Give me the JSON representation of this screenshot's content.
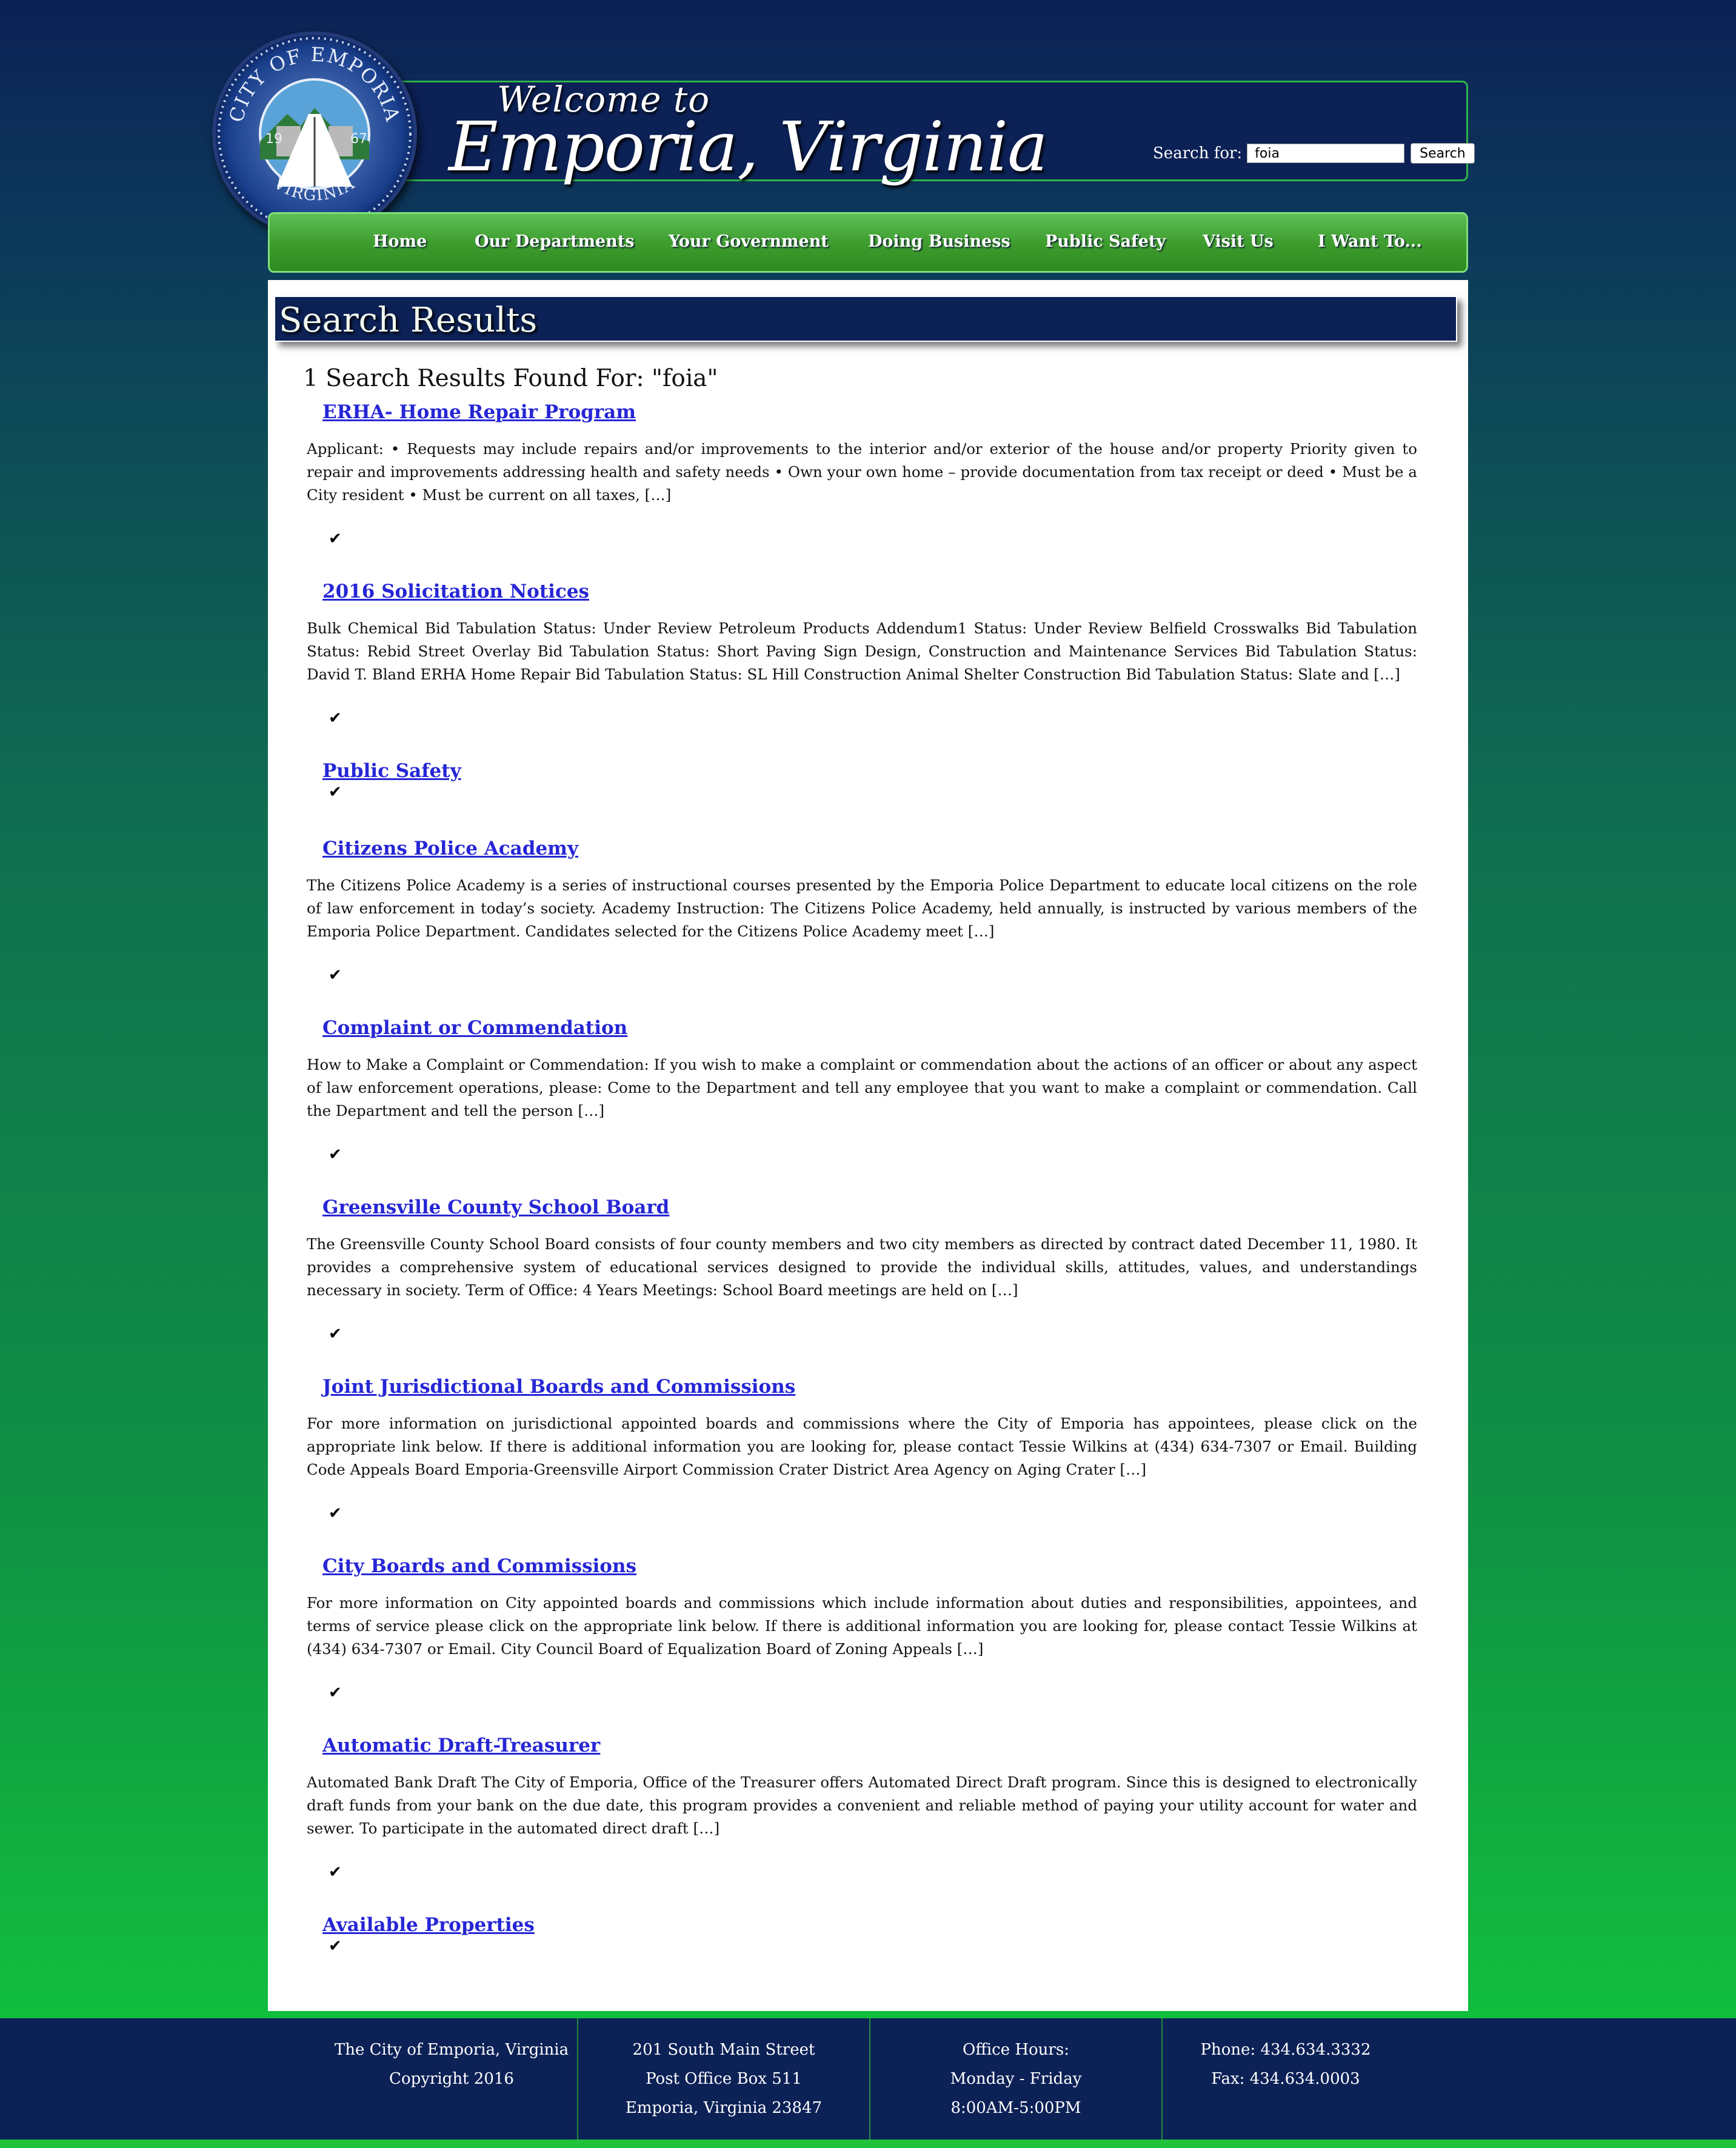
{
  "header": {
    "seal": {
      "top_text": "CITY OF EMPORIA",
      "bottom_text": "VIRGINIA",
      "year_left": "19",
      "year_right": "67"
    },
    "welcome": "Welcome to",
    "city": "Emporia, Virginia",
    "search": {
      "label": "Search for:",
      "value": "foia",
      "button": "Search"
    }
  },
  "nav": {
    "items": [
      "Home",
      "Our Departments",
      "Your Government",
      "Doing Business",
      "Public Safety",
      "Visit Us",
      "I Want To..."
    ]
  },
  "main": {
    "heading": "Search Results",
    "count_text": "1 Search Results Found For: \"foia\"",
    "results": [
      {
        "title": "ERHA- Home Repair Program",
        "excerpt": "Applicant: • Requests may include repairs and/or improvements to the interior and/or exterior of the house and/or property Priority given to repair and improvements addressing health and safety needs • Own your own home – provide documentation from tax receipt or deed • Must be a City resident • Must be current on all taxes, […]"
      },
      {
        "title": "2016 Solicitation Notices",
        "excerpt": "Bulk Chemical Bid Tabulation Status: Under Review Petroleum Products Addendum1 Status: Under Review Belfield Crosswalks Bid Tabulation Status: Rebid Street Overlay Bid Tabulation Status: Short Paving Sign Design, Construction and Maintenance Services Bid Tabulation Status: David T. Bland ERHA Home Repair Bid Tabulation Status: SL Hill Construction Animal Shelter Construction Bid Tabulation Status: Slate and […]"
      },
      {
        "title": "Public Safety",
        "excerpt": ""
      },
      {
        "title": "Citizens Police Academy",
        "excerpt": "The Citizens Police Academy is a series of instructional courses presented by the Emporia Police Department to educate local citizens on the role of law enforcement in today’s society. Academy Instruction: The Citizens Police Academy, held annually, is instructed by various members of the Emporia Police Department. Candidates selected for the Citizens Police Academy meet […]"
      },
      {
        "title": "Complaint or Commendation",
        "excerpt": "How to Make a Complaint or Commendation: If you wish to make a complaint or commendation about the actions of an officer or about any aspect of law enforcement operations, please: Come to the Department and tell any employee that you want to make a complaint or commendation. Call the Department and tell the person […]"
      },
      {
        "title": "Greensville County School Board",
        "excerpt": "The Greensville County School Board consists of four county members and two city members as directed by contract dated December 11, 1980. It provides a comprehensive system of educational services designed to provide the individual skills, attitudes, values, and understandings necessary in society. Term of Office: 4 Years Meetings: School Board meetings are held on […]"
      },
      {
        "title": "Joint Jurisdictional Boards and Commissions",
        "excerpt": "For more information on jurisdictional appointed boards and commissions where the City of Emporia has appointees, please click on the appropriate link below. If there is additional information you are looking for, please contact Tessie Wilkins at (434) 634-7307 or Email. Building Code Appeals Board Emporia-Greensville Airport Commission Crater District Area Agency on Aging Crater […]"
      },
      {
        "title": "City Boards and Commissions",
        "excerpt": "For more information on City appointed boards and commissions which include information about duties and responsibilities, appointees, and terms of service please click on the appropriate link below. If there is additional information you are looking for, please contact Tessie Wilkins at (434) 634-7307 or Email. City Council Board of Equalization Board of Zoning Appeals […]"
      },
      {
        "title": "Automatic Draft-Treasurer",
        "excerpt": "Automated Bank Draft The City of Emporia, Office of the Treasurer offers Automated Direct Draft program. Since this is designed to electronically draft funds from your bank on the due date, this program provides a convenient and reliable method of paying your utility account for water and sewer. To participate in the automated direct draft […]"
      },
      {
        "title": "Available Properties",
        "excerpt": ""
      }
    ],
    "check_glyph": "✔"
  },
  "footer": {
    "col1": [
      "The City of Emporia, Virginia",
      "Copyright 2016"
    ],
    "col2": [
      "201 South Main Street",
      "Post Office Box 511",
      "Emporia, Virginia 23847"
    ],
    "col3": [
      "Office Hours:",
      "Monday - Friday",
      "8:00AM-5:00PM"
    ],
    "col4": [
      "Phone: 434.634.3332",
      "Fax: 434.634.0003"
    ]
  },
  "colors": {
    "navy": "#0c2156",
    "nav_green": "#3d9b2c",
    "link_blue": "#2626d6",
    "footer_divider": "#1f8a3e"
  }
}
